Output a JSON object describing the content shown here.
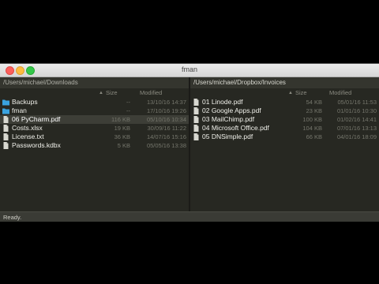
{
  "window": {
    "title": "fman"
  },
  "left_pane": {
    "path": "/Users/michael/Downloads",
    "columns": {
      "size": "Size",
      "modified": "Modified"
    },
    "rows": [
      {
        "name": "Backups",
        "size": "--",
        "modified": "13/10/16 14:37",
        "icon": "folder-icon",
        "selected": false
      },
      {
        "name": "fman",
        "size": "--",
        "modified": "17/10/16 19:26",
        "icon": "folder-icon",
        "selected": false
      },
      {
        "name": "06 PyCharm.pdf",
        "size": "116 KB",
        "modified": "05/10/16 10:34",
        "icon": "file-icon",
        "selected": true
      },
      {
        "name": "Costs.xlsx",
        "size": "19 KB",
        "modified": "30/09/16 11:22",
        "icon": "file-icon",
        "selected": false
      },
      {
        "name": "License.txt",
        "size": "36 KB",
        "modified": "14/07/16 15:16",
        "icon": "file-icon",
        "selected": false
      },
      {
        "name": "Passwords.kdbx",
        "size": "5 KB",
        "modified": "05/05/16 13:38",
        "icon": "file-icon",
        "selected": false
      }
    ]
  },
  "right_pane": {
    "path": "/Users/michael/Dropbox/Invoices",
    "columns": {
      "size": "Size",
      "modified": "Modified"
    },
    "rows": [
      {
        "name": "01 Linode.pdf",
        "size": "54 KB",
        "modified": "05/01/16 11:53",
        "icon": "file-icon"
      },
      {
        "name": "02 Google Apps.pdf",
        "size": "23 KB",
        "modified": "01/01/16 10:30",
        "icon": "file-icon"
      },
      {
        "name": "03 MailChimp.pdf",
        "size": "100 KB",
        "modified": "01/02/16 14:41",
        "icon": "file-icon"
      },
      {
        "name": "04 Microsoft Office.pdf",
        "size": "104 KB",
        "modified": "07/01/16 13:13",
        "icon": "file-icon"
      },
      {
        "name": "05 DNSimple.pdf",
        "size": "66 KB",
        "modified": "04/01/16 18:09",
        "icon": "file-icon"
      }
    ]
  },
  "status": {
    "text": "Ready."
  },
  "colors": {
    "folder": "#3aa3e0",
    "file": "#d8d8d0",
    "selected_row": "#3d3e37"
  }
}
